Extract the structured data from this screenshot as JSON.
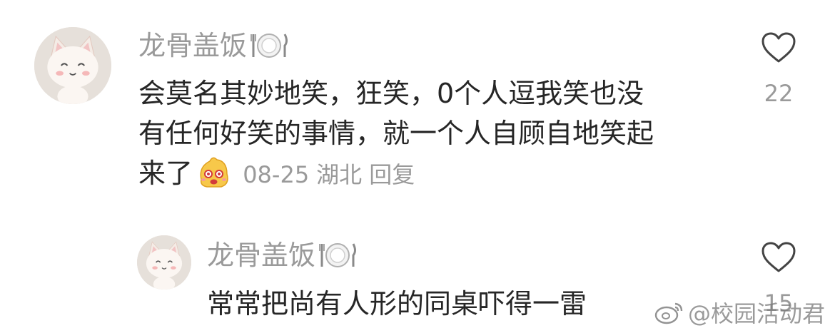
{
  "comment": {
    "username": "龙骨盖饭",
    "username_icon": "plate-cutlery-icon",
    "content_lines": [
      "会莫名其妙地笑，狂笑，0个人逗我笑也没",
      "有任何好笑的事情，就一个人自顾自地笑起",
      "来了"
    ],
    "emoji": "happy-face-emoji",
    "date": "08-25",
    "location": "湖北",
    "reply_label": "回复",
    "like_icon": "heart-outline-icon",
    "like_count": "22"
  },
  "reply": {
    "username": "龙骨盖饭",
    "username_icon": "plate-cutlery-icon",
    "content": "常常把尚有人形的同桌吓得一雷",
    "like_icon": "heart-outline-icon",
    "like_count": "15"
  },
  "watermark": {
    "icon": "weibo-logo-icon",
    "text": "@校园活动君"
  },
  "colors": {
    "username": "#9a9a9a",
    "text": "#262626",
    "meta": "#9a9a9a",
    "heart_stroke": "#444444"
  }
}
